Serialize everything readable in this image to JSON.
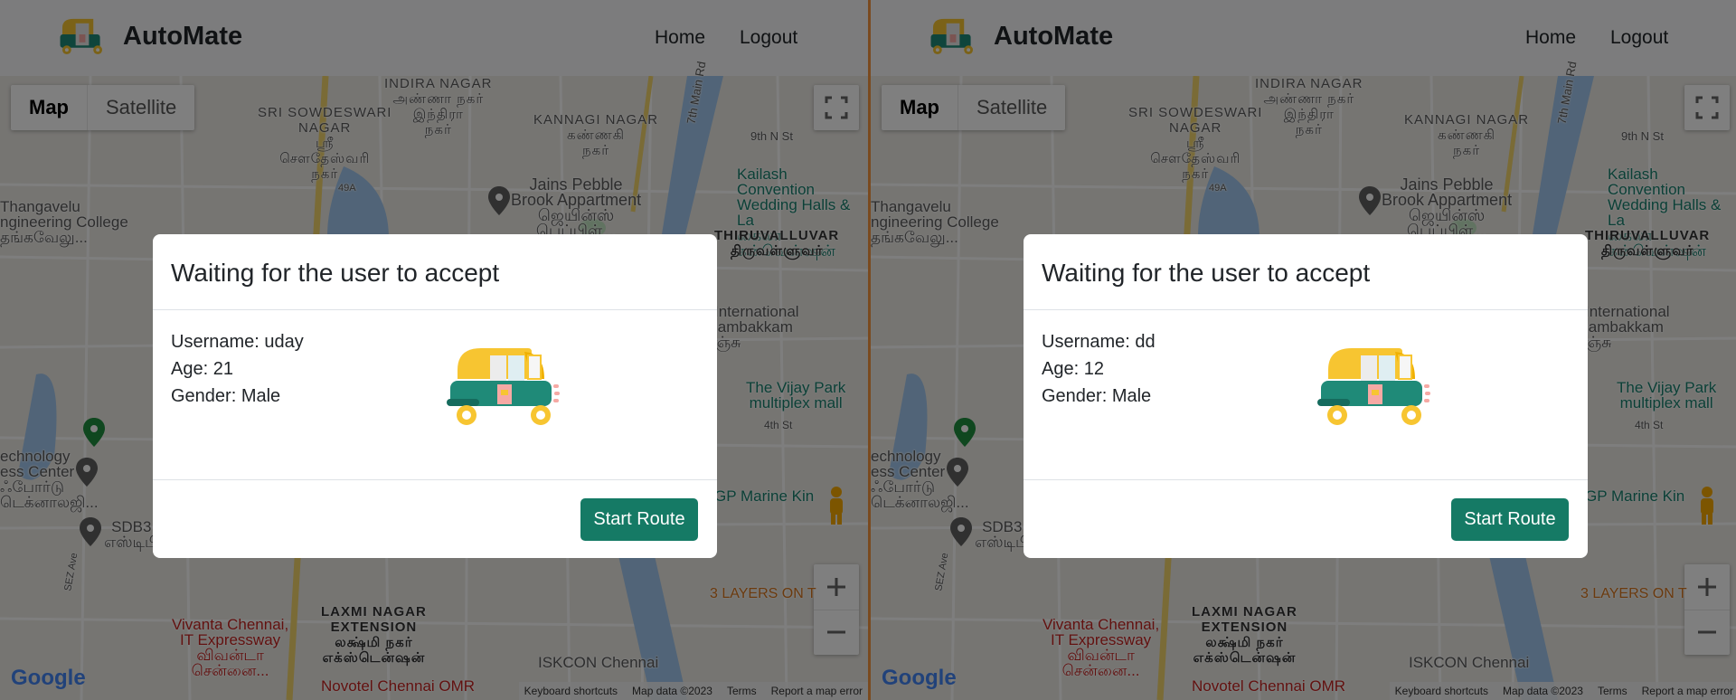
{
  "panes": [
    {
      "navbar": {
        "brand": "AutoMate",
        "links": [
          "Home",
          "Logout"
        ]
      },
      "map": {
        "type_buttons": [
          "Map",
          "Satellite"
        ],
        "active_type": "Map",
        "labels": [
          "INDIRA NAGAR",
          "அண்ணா நகர்",
          "இந்திரா",
          "நகர்",
          "SRI SOWDESWARI",
          "NAGAR",
          "ஸ்ரீ",
          "சௌதேஸ்வரி",
          "நகர்",
          "KANNAGI NAGAR",
          "கண்ணகி",
          "நகர்",
          "7th Main Rd",
          "9th N St",
          "49A",
          "Jains Pebble",
          "Brook Appartment",
          "ஜெயின்ஸ்",
          "பெப்பிள்...",
          "Kailash Convention",
          "Wedding Halls & La",
          "கைலா",
          "கன்வென்ஷன்",
          "Thangavelu",
          "ngineering College",
          "தங்கவேலு...",
          "THIRUVALLUVAR",
          "திருவள்ளுவர்",
          "International",
          "jambakkam",
          "ஞ்சு",
          "The Vijay Park",
          "multiplex mall",
          "4th St",
          "echnology",
          "ess Center",
          "ஃபோர்டு",
          "டெக்னாலஜி...",
          "SDB3",
          "எஸ்டிபி",
          "GP Marine Kin",
          "SEZ Ave",
          "Vivanta Chennai,",
          "IT Expressway",
          "விவன்டா",
          "சென்னை...",
          "LAXMI NAGAR",
          "EXTENSION",
          "லக்ஷ்மி நகர்",
          "எக்ஸ்டென்ஷன்",
          "ISKCON Chennai",
          "3 LAYERS ON T",
          "Novotel Chennai OMR"
        ],
        "google": "Google",
        "attribution": [
          "Keyboard shortcuts",
          "Map data ©2023",
          "Terms",
          "Report a map error"
        ]
      },
      "modal": {
        "title": "Waiting for the user to accept",
        "username": "Username: uday",
        "age": "Age: 21",
        "gender": "Gender: Male",
        "button": "Start Route"
      }
    },
    {
      "navbar": {
        "brand": "AutoMate",
        "links": [
          "Home",
          "Logout"
        ]
      },
      "map": {
        "type_buttons": [
          "Map",
          "Satellite"
        ],
        "active_type": "Map",
        "labels": [
          "INDIRA NAGAR",
          "அண்ணா நகர்",
          "இந்திரா",
          "நகர்",
          "SRI SOWDESWARI",
          "NAGAR",
          "ஸ்ரீ",
          "சௌதேஸ்வரி",
          "நகர்",
          "KANNAGI NAGAR",
          "கண்ணகி",
          "நகர்",
          "7th Main Rd",
          "9th N St",
          "49A",
          "Jains Pebble",
          "Brook Appartment",
          "ஜெயின்ஸ்",
          "பெப்பிள்...",
          "Kailash Convention",
          "Wedding Halls & La",
          "கைலா",
          "கன்வென்ஷன்",
          "Thangavelu",
          "ngineering College",
          "தங்கவேலு...",
          "THIRUVALLUVAR",
          "திருவள்ளுவர்",
          "International",
          "jambakkam",
          "ஞ்சு",
          "The Vijay Park",
          "multiplex mall",
          "4th St",
          "echnology",
          "ess Center",
          "ஃபோர்டு",
          "டெக்னாலஜி...",
          "SDB3",
          "எஸ்டிபி",
          "GP Marine Kin",
          "SEZ Ave",
          "Vivanta Chennai,",
          "IT Expressway",
          "விவன்டா",
          "சென்னை...",
          "LAXMI NAGAR",
          "EXTENSION",
          "லக்ஷ்மி நகர்",
          "எக்ஸ்டென்ஷன்",
          "ISKCON Chennai",
          "3 LAYERS ON T",
          "Novotel Chennai OMR"
        ],
        "google": "Google",
        "attribution": [
          "Keyboard shortcuts",
          "Map data ©2023",
          "Terms",
          "Report a map error"
        ]
      },
      "modal": {
        "title": "Waiting for the user to accept",
        "username": "Username: dd",
        "age": "Age: 12",
        "gender": "Gender: Male",
        "button": "Start Route"
      }
    }
  ],
  "colors": {
    "primary": "#157a65",
    "divider": "#7a4a1f",
    "overlay": "rgba(0,0,0,0.5)"
  },
  "icons": [
    "auto-rickshaw-icon",
    "fullscreen-icon",
    "zoom-in-icon",
    "zoom-out-icon",
    "pegman-icon",
    "map-pin-icon"
  ]
}
